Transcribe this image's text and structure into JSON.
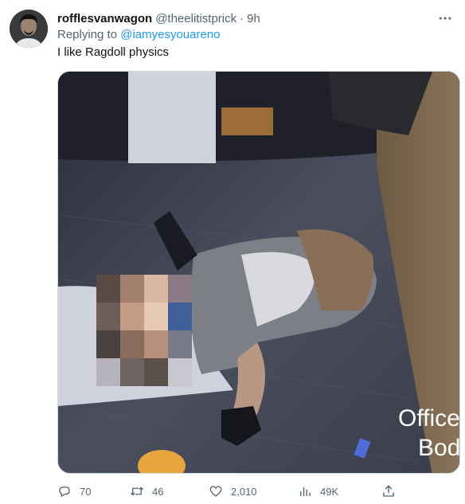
{
  "tweet": {
    "display_name": "rofflesvanwagon",
    "handle": "@theelitistprick",
    "separator": "·",
    "time": "9h",
    "replying_prefix": "Replying to",
    "replying_to": "@iamyesyouareno",
    "text": "I like Ragdoll physics",
    "more_icon": "more-horizontal-icon",
    "media": {
      "overlay_line1": "Office",
      "overlay_line2": "Bod",
      "content_obscured": true
    }
  },
  "actions": {
    "reply": {
      "icon": "reply-icon",
      "count": "70"
    },
    "retweet": {
      "icon": "retweet-icon",
      "count": "46"
    },
    "like": {
      "icon": "heart-icon",
      "count": "2,010"
    },
    "views": {
      "icon": "bar-chart-icon",
      "count": "49K"
    },
    "share": {
      "icon": "share-icon"
    }
  },
  "colors": {
    "link": "#1d9bf0",
    "secondary_text": "#536471",
    "primary_text": "#0f1419",
    "border": "#cfd9de"
  }
}
